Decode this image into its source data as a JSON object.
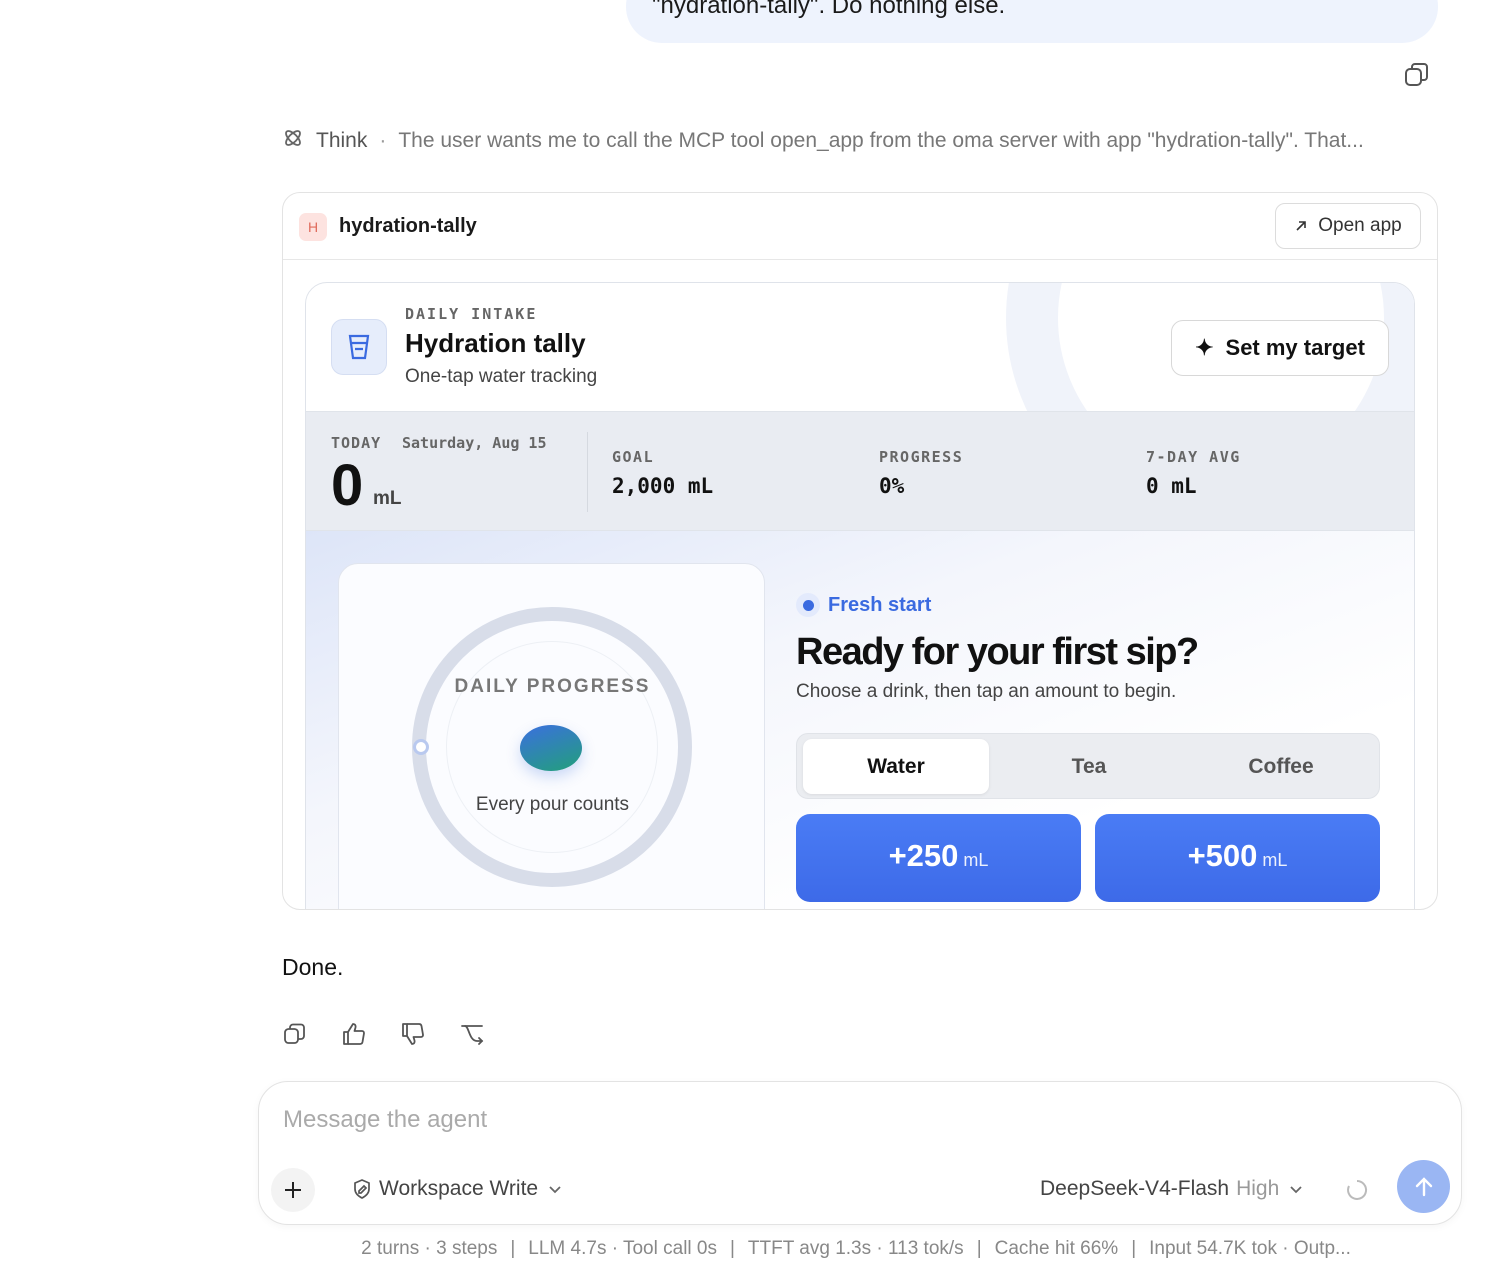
{
  "user_message": {
    "text": "\"hydration-tally\". Do nothing else."
  },
  "think": {
    "label": "Think",
    "text": "The user wants me to call the MCP tool open_app from the oma server with app \"hydration-tally\". That..."
  },
  "app_card": {
    "badge": "H",
    "name": "hydration-tally",
    "open_label": "Open app"
  },
  "app": {
    "eyebrow": "DAILY INTAKE",
    "title": "Hydration tally",
    "subtitle": "One-tap water tracking",
    "target_button": "Set my target",
    "stats": {
      "today_label": "TODAY",
      "date": "Saturday, Aug 15",
      "today_value": "0",
      "today_unit": "mL",
      "goal_label": "GOAL",
      "goal_value": "2,000 mL",
      "progress_label": "PROGRESS",
      "progress_value": "0%",
      "avg_label": "7-DAY AVG",
      "avg_value": "0 mL"
    },
    "progress_card": {
      "label": "DAILY PROGRESS",
      "caption": "Every pour counts",
      "progress_fraction": 0
    },
    "status": "Fresh start",
    "headline": "Ready for your first sip?",
    "instruction": "Choose a drink, then tap an amount to begin.",
    "drinks": [
      "Water",
      "Tea",
      "Coffee"
    ],
    "selected_drink": "Water",
    "amounts": [
      {
        "value": "+250",
        "unit": "mL"
      },
      {
        "value": "+500",
        "unit": "mL"
      }
    ]
  },
  "reply": {
    "text": "Done."
  },
  "composer": {
    "placeholder": "Message the agent",
    "mode": "Workspace Write",
    "model": "DeepSeek-V4-Flash",
    "effort": "High"
  },
  "footer": {
    "items": [
      "2 turns · 3 steps",
      "LLM 4.7s · Tool call 0s",
      "TTFT avg 1.3s · 113 tok/s",
      "Cache hit 66%",
      "Input 54.7K tok · Outp..."
    ],
    "separator": "|"
  },
  "colors": {
    "accent": "#3d6ae8",
    "bubble": "#eef3fd",
    "send_disabled": "#9ab6f3"
  }
}
